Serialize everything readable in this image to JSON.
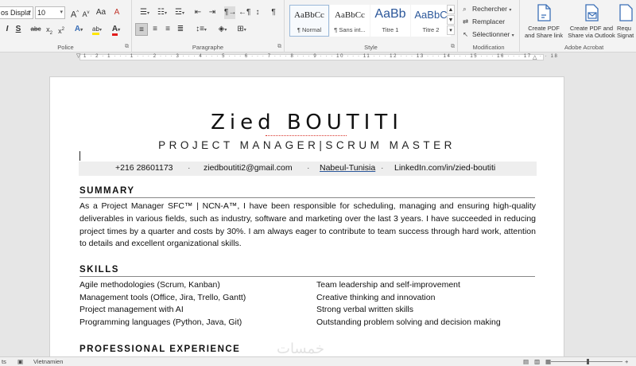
{
  "ribbon": {
    "font": {
      "font_name": "os Displa",
      "font_size": "10",
      "grow_font": "A",
      "shrink_font": "A",
      "change_case": "Aa",
      "clear_format": "A",
      "bold": "I",
      "italic": "S",
      "strike": "abc",
      "subscript": "x",
      "superscript": "x",
      "effects": "A",
      "highlight": "ab",
      "font_color": "A",
      "label": "Police"
    },
    "paragraph": {
      "label": "Paragraphe",
      "pilcrow": "¶"
    },
    "styles": {
      "label": "Style",
      "items": [
        {
          "sample": "AaBbCc",
          "name": "¶ Normal"
        },
        {
          "sample": "AaBbCc",
          "name": "¶ Sans int..."
        },
        {
          "sample": "AaBb",
          "name": "Titre 1"
        },
        {
          "sample": "AaBbC",
          "name": "Titre 2"
        }
      ]
    },
    "editing": {
      "label": "Modification",
      "find": "Rechercher",
      "replace": "Remplacer",
      "select": "Sélectionner"
    },
    "acrobat": {
      "label": "Adobe Acrobat",
      "btn1_l1": "Create PDF",
      "btn1_l2": "and Share link",
      "btn2_l1": "Create PDF and",
      "btn2_l2": "Share via Outlook",
      "btn3_l1": "Requ",
      "btn3_l2": "Signat"
    }
  },
  "ruler": {
    "marks": "1 · 2 · 1 · · · 1 · · · 2 · · · 3 · · · 4 · · · 5 · · · 6 · · · 7 · · · 8 · · · 9 · · · 10 · · · 11 · · · 12 · · · 13 · · · 14 · · · 15 · · · 16 · · · 17 · · · 18"
  },
  "document": {
    "name": "Zied BOUTITI",
    "subtitle": "PROJECT MANAGER|SCRUM MASTER",
    "contact": {
      "phone": "+216 28601173",
      "email": "ziedboutiti2@gmail.com",
      "location": "Nabeul-Tunisia",
      "linkedin": "LinkedIn.com/in/zied-boutiti",
      "separator": "·"
    },
    "summary_heading": "SUMMARY",
    "summary_text": "As a Project Manager SFC™ | NCN-A™, I have been responsible for scheduling, managing and ensuring high-quality deliverables in various fields, such as industry, software and marketing over the last 3 years. I have succeeded in reducing project times by a quarter and costs by 30%. I am always eager to contribute to team success through hard work, attention to details and excellent organizational skills.",
    "skills_heading": "SKILLS",
    "skills_left": [
      "Agile methodologies (Scrum, Kanban)",
      "Management tools (Office, Jira, Trello, Gantt)",
      "Project management with AI",
      "Programming languages (Python, Java, Git)"
    ],
    "skills_right": [
      "Team leadership and self-improvement",
      "Creative thinking and innovation",
      "Strong verbal written skills",
      "Outstanding problem solving and decision making"
    ],
    "experience_heading": "PROFESSIONAL EXPERIENCE"
  },
  "watermark": "خمسات",
  "statusbar": {
    "left": "ts",
    "language": "Vietnamien"
  }
}
